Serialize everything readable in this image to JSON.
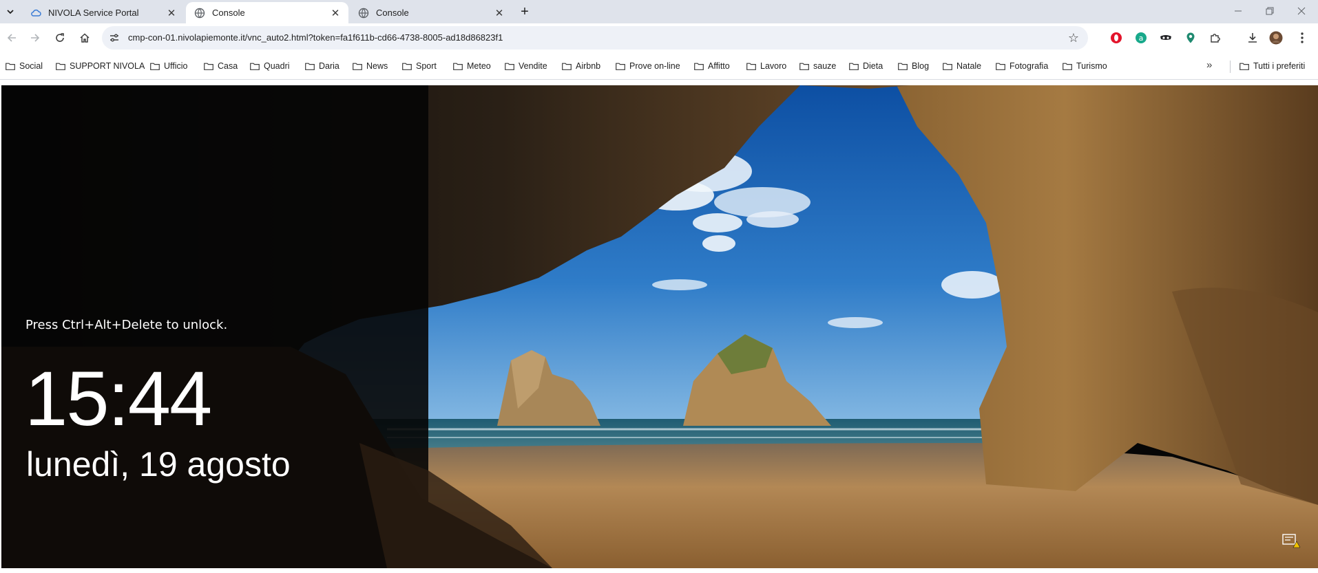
{
  "tabs": [
    {
      "title": "NIVOLA Service Portal",
      "active": false,
      "favicon": "cloud-icon"
    },
    {
      "title": "Console",
      "active": true,
      "favicon": "globe-icon"
    },
    {
      "title": "Console",
      "active": false,
      "favicon": "globe-icon"
    }
  ],
  "omnibox": {
    "url": "cmp-con-01.nivolapiemonte.it/vnc_auto2.html?token=fa1f611b-cd66-4738-8005-ad18d86823f1"
  },
  "bookmarks": [
    "Social",
    "SUPPORT NIVOLA",
    "Ufficio",
    "Casa",
    "Quadri",
    "Daria",
    "News",
    "Sport",
    "Meteo",
    "Vendite",
    "Airbnb",
    "Prove on-line",
    "Affitto",
    "Lavoro",
    "sauze",
    "Dieta",
    "Blog",
    "Natale",
    "Fotografia",
    "Turismo"
  ],
  "bookmarks_more": "»",
  "all_bookmarks": "Tutti i preferiti",
  "lockscreen": {
    "hint": "Press Ctrl+Alt+Delete to unlock.",
    "time": "15:44",
    "date": "lunedì, 19 agosto"
  },
  "colors": {
    "tabstrip": "#dfe3eb",
    "omnibox": "#eef1f7",
    "sky": "#2f7cc8",
    "sand": "#b38855"
  },
  "icons": {
    "back": "arrow-left-icon",
    "forward": "arrow-right-icon",
    "reload": "reload-icon",
    "home": "home-icon",
    "bookmark_star": "star-icon",
    "downloads": "download-icon",
    "menu": "kebab-menu-icon",
    "accessibility": "ease-of-access-icon"
  }
}
